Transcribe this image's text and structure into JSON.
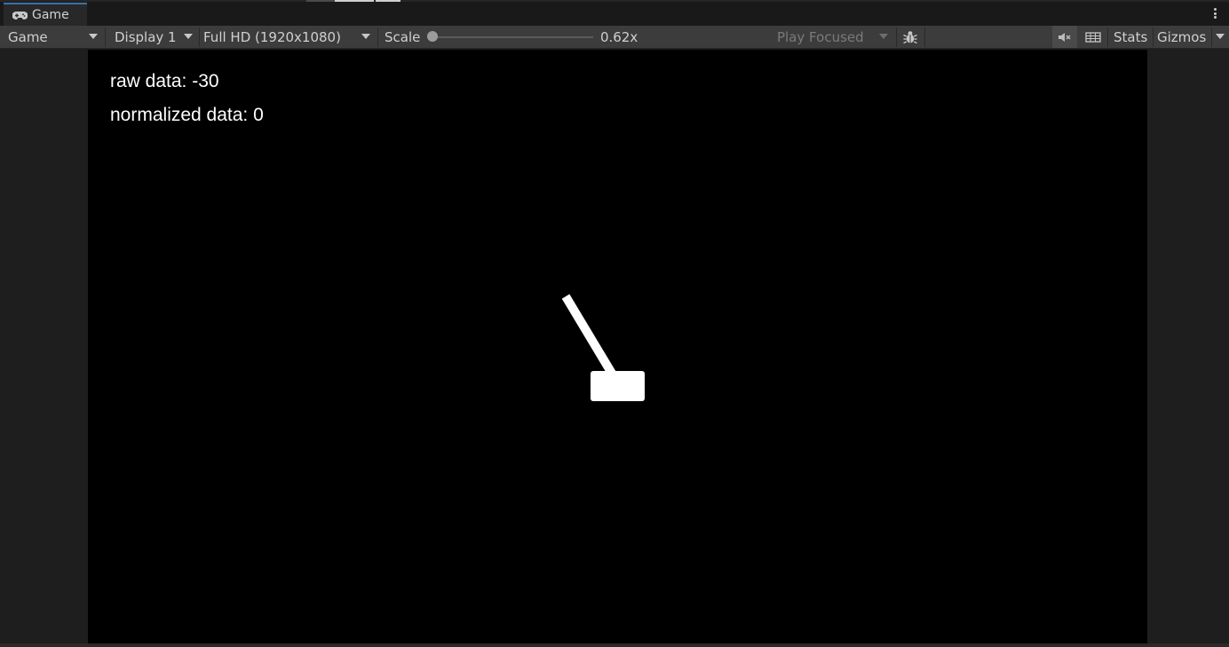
{
  "tab": {
    "label": "Game",
    "icon": "gamepad-icon"
  },
  "toolbar": {
    "view_mode": "Game",
    "display": "Display 1",
    "resolution": "Full HD (1920x1080)",
    "scale_label": "Scale",
    "scale_value": "0.62x",
    "play_mode": "Play Focused",
    "stats_label": "Stats",
    "gizmos_label": "Gizmos"
  },
  "game": {
    "raw_data": "raw data: -30",
    "normalized_data": "normalized data: 0"
  },
  "colors": {
    "accent": "#3d6fa8",
    "toolbar": "#3c3c3c",
    "viewport": "#000000",
    "object": "#ffffff"
  }
}
